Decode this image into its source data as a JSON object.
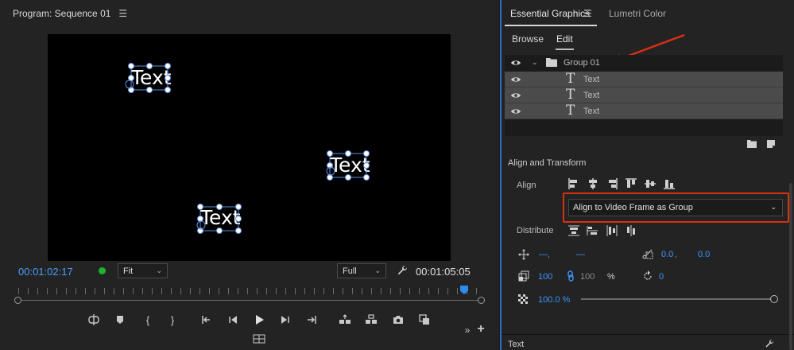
{
  "program": {
    "title": "Program: Sequence 01",
    "menu_icon": "hamburger-menu-icon",
    "video_texts": [
      "Text",
      "Text",
      "Text"
    ],
    "timecode_current": "00:01:02:17",
    "zoom_label": "Fit",
    "resolution_label": "Full",
    "timecode_duration": "00:01:05:05"
  },
  "essential_graphics": {
    "tab_active": "Essential Graphics",
    "tab_inactive": "Lumetri Color",
    "subtab_browse": "Browse",
    "subtab_edit": "Edit",
    "layers": [
      {
        "label": "Group 01",
        "type": "group"
      },
      {
        "label": "Text",
        "type": "text"
      },
      {
        "label": "Text",
        "type": "text"
      },
      {
        "label": "Text",
        "type": "text"
      }
    ],
    "align_transform_title": "Align and Transform",
    "align_label": "Align",
    "align_dropdown_value": "Align to Video Frame as Group",
    "distribute_label": "Distribute",
    "position_x": "—",
    "position_sep": ",",
    "position_y": "—",
    "anchor_x": "0.0",
    "anchor_sep": ",",
    "anchor_y": "0.0",
    "scale_value": "100",
    "scale_locked_value": "100",
    "scale_unit": "%",
    "rotation_value": "0",
    "opacity_value": "100.0 %",
    "text_section_title": "Text"
  },
  "colors": {
    "accent_blue": "#3b95ff",
    "highlight_red": "#d9300f",
    "panel_focus": "#2d6cc0"
  }
}
